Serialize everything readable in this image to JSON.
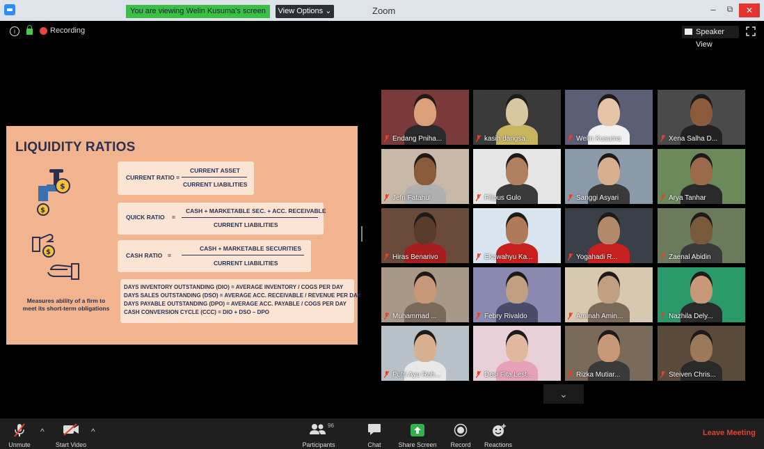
{
  "window": {
    "title": "Zoom",
    "share_banner": "You are viewing Welin Kusuma's screen",
    "view_options": "View Options ⌄",
    "min_glyph": "–",
    "max_glyph": "⧉",
    "close_glyph": "✕"
  },
  "meeting": {
    "recording_label": "Recording",
    "speaker_view": "Speaker View",
    "info_glyph": "i"
  },
  "slide": {
    "title": "LIQUIDITY RATIOS",
    "current_label": "CURRENT RATIO =",
    "current_num": "CURRENT ASSET",
    "current_den": "CURRENT LIABILITIES",
    "quick_label": "QUICK RATIO",
    "quick_eq": "=",
    "quick_num": "CASH + MARKETABLE SEC. + ACC. RECEIVABLE",
    "quick_den": "CURRENT LIABILITIES",
    "cash_label": "CASH RATIO",
    "cash_eq": "=",
    "cash_num": "CASH + MARKETABLE SECURITIES",
    "cash_den": "CURRENT LIABILITIES",
    "days": [
      "DAYS INVENTORY OUTSTANDING (DIO) = AVERAGE INVENTORY / COGS PER DAY",
      "DAYS SALES OUTSTANDING (DSO) = AVERAGE ACC. RECEIVABLE / REVENUE PER DAY",
      "DAYS PAYABLE OUTSTANDING (DPO) = AVERAGE ACC. PAYABLE / COGS PER DAY",
      "CASH CONVERSION CYCLE (CCC) = DIO + DSO – DPO"
    ],
    "measures_line1": "Measures ability of a firm to",
    "measures_line2": "meet its short-term obligations"
  },
  "participants": [
    {
      "name": "Endang Pniha...",
      "bg": "#7a3a3a",
      "skin": "#d9a07a",
      "cloth": "#2a2a2a",
      "active": false
    },
    {
      "name": "kasih dangsa...",
      "bg": "#3a3a3a",
      "skin": "#d8c8a0",
      "cloth": "#c9b560",
      "active": false
    },
    {
      "name": "Welin Kusuma",
      "bg": "#5a5f75",
      "skin": "#e6c4a8",
      "cloth": "#f0f0f0",
      "active": true
    },
    {
      "name": "Xena Salha D...",
      "bg": "#4a4a4a",
      "skin": "#8a5a3a",
      "cloth": "#222222",
      "active": false
    },
    {
      "name": "Jefri Fatahul",
      "bg": "#c8b8a8",
      "skin": "#8a5a3a",
      "cloth": "#b0b0b0",
      "active": false
    },
    {
      "name": "Filipus Gulo",
      "bg": "#e5e5e5",
      "skin": "#b08060",
      "cloth": "#3a3a3a",
      "active": false
    },
    {
      "name": "Sanggi Asyari",
      "bg": "#8a9aa8",
      "skin": "#d8b090",
      "cloth": "#3a3a3a",
      "active": false
    },
    {
      "name": "Arya Tanhar",
      "bg": "#6a8a5a",
      "skin": "#9a6a4a",
      "cloth": "#2a2a2a",
      "active": false
    },
    {
      "name": "Hiras Benarivo",
      "bg": "#6a4a3a",
      "skin": "#5a3a2a",
      "cloth": "#a81e1e",
      "active": false
    },
    {
      "name": "Ekawahyu Ka...",
      "bg": "#d8e4ee",
      "skin": "#b07a5a",
      "cloth": "#c8201e",
      "active": false
    },
    {
      "name": "Yogahadi R...",
      "bg": "#3a3f48",
      "skin": "#b08a6a",
      "cloth": "#c8201e",
      "active": false
    },
    {
      "name": "Zaenal Abidin",
      "bg": "#6a7a5a",
      "skin": "#7a5a3a",
      "cloth": "#3a3a3a",
      "active": false
    },
    {
      "name": "Muhammad ...",
      "bg": "#a89888",
      "skin": "#c89878",
      "cloth": "#7a6a5a",
      "active": false
    },
    {
      "name": "Febry Rivaldo",
      "bg": "#8a8ab0",
      "skin": "#c0a080",
      "cloth": "#4a4a6a",
      "active": false
    },
    {
      "name": "Aminah Amin...",
      "bg": "#d8c8b0",
      "skin": "#c0a080",
      "cloth": "#7a6a5a",
      "active": false
    },
    {
      "name": "Nazhila Dely...",
      "bg": "#2a9a6a",
      "skin": "#c89878",
      "cloth": "#2a2a2a",
      "active": false
    },
    {
      "name": "Putri Ayu Rah...",
      "bg": "#b8c0c8",
      "skin": "#d8b090",
      "cloth": "#e8e8e8",
      "active": false
    },
    {
      "name": "Desi Fita Lest...",
      "bg": "#e8d0d8",
      "skin": "#e0b8a0",
      "cloth": "#e8a0b8",
      "active": false
    },
    {
      "name": "Rizka Mutiar...",
      "bg": "#7a6a5a",
      "skin": "#c89878",
      "cloth": "#3a3a3a",
      "active": false
    },
    {
      "name": "Steiven Chris...",
      "bg": "#5a4a3a",
      "skin": "#9a7a5a",
      "cloth": "#2a2a2a",
      "active": false
    }
  ],
  "toolbar": {
    "unmute": "Unmute",
    "start_video": "Start Video",
    "participants": "Participants",
    "participants_count": "96",
    "chat": "Chat",
    "share_screen": "Share Screen",
    "record": "Record",
    "reactions": "Reactions",
    "leave": "Leave Meeting",
    "caret_glyph": "^",
    "gallery_next_glyph": "⌄"
  },
  "colors": {
    "slide_bg": "#f2b48e",
    "slide_text": "#2a3150",
    "share_banner": "#3bbf45",
    "active_speaker": "#c8e63a",
    "leave": "#e5412d"
  }
}
